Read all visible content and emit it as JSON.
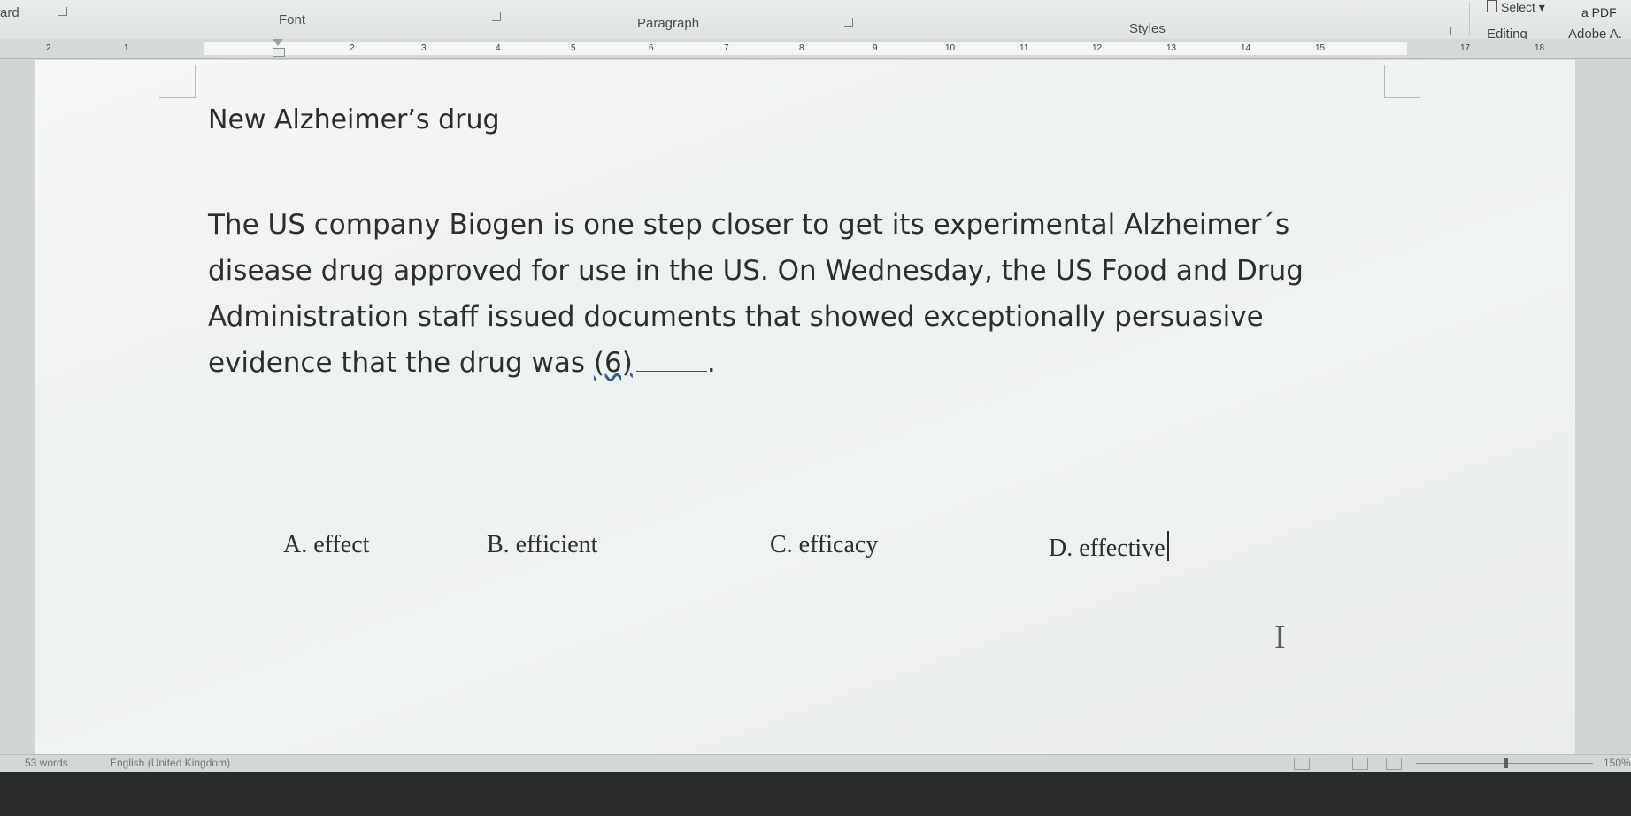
{
  "ribbon": {
    "clipboard_label": "ard",
    "font_label": "Font",
    "paragraph_label": "Paragraph",
    "styles_label": "Styles",
    "select_label": "Select",
    "pdf_label": "a PDF",
    "editing_label": "Editing",
    "adobe_label": "Adobe A."
  },
  "ruler": {
    "ticks": [
      "2",
      "1",
      "2",
      "3",
      "4",
      "5",
      "6",
      "7",
      "8",
      "9",
      "10",
      "11",
      "12",
      "13",
      "14",
      "15",
      "17",
      "18"
    ]
  },
  "document": {
    "title": "New Alzheimer’s drug",
    "paragraph_lines": [
      "The US company Biogen is one step closer to get its experimental Alzheimer´s",
      "disease drug approved for use in the US. On Wednesday, the US Food and Drug",
      "Administration staff issued documents that showed exceptionally persuasive"
    ],
    "last_line_text": "evidence that the drug was ",
    "question_number": "(6)",
    "period": ".",
    "options": {
      "a": "A. effect",
      "b": "B. efficient",
      "c": "C. efficacy",
      "d": "D. effective"
    }
  },
  "status": {
    "word_count": "53 words",
    "language": "English (United Kingdom)",
    "zoom": "150%"
  }
}
